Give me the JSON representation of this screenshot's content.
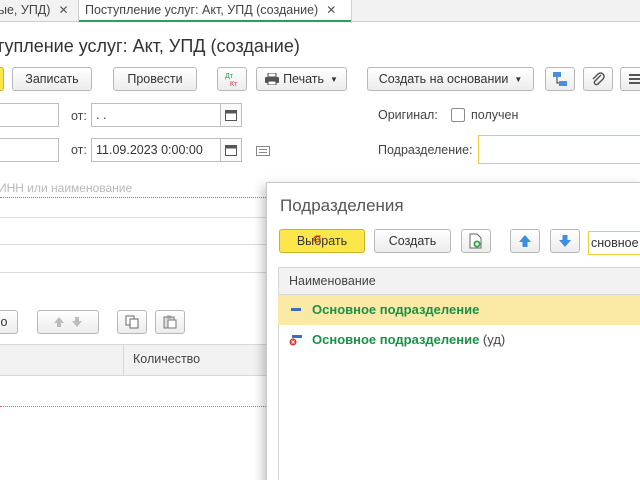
{
  "tabs": [
    {
      "label": "ые, УПД)",
      "close": "✕"
    },
    {
      "label": "Поступление услуг: Акт, УПД (создание)",
      "close": "✕"
    }
  ],
  "document": {
    "title": "тупление услуг: Акт, УПД (создание)",
    "toolbar": {
      "write": "Записать",
      "post": "Провести",
      "print": "Печать",
      "create_based": "Создать на основании"
    },
    "fields": {
      "from_label_1": "от:",
      "date_1": ".  .",
      "from_label_2": "от:",
      "date_2": "11.09.2023  0:00:00",
      "original_label": "Оригинал:",
      "original_checkbox_label": "получен",
      "division_label": "Подразделение:",
      "counterparty_placeholder": "ИНН или наименование"
    },
    "table": {
      "col_quantity": "Количество",
      "btn_partial": "о"
    }
  },
  "popup": {
    "title": "Подразделения",
    "select_button": "Выбрать",
    "create_button": "Создать",
    "search_value": "сновное",
    "column_name": "Наименование",
    "rows": [
      {
        "name": "Основное подразделение",
        "suffix": "",
        "selected": true
      },
      {
        "name": "Основное подразделение",
        "suffix": " (уд)",
        "selected": false
      }
    ]
  },
  "colors": {
    "accent_yellow": "#fbe74a",
    "name_green": "#1a9147",
    "selected_row": "#fbe9a6",
    "tab_underline": "#2aa05a"
  }
}
